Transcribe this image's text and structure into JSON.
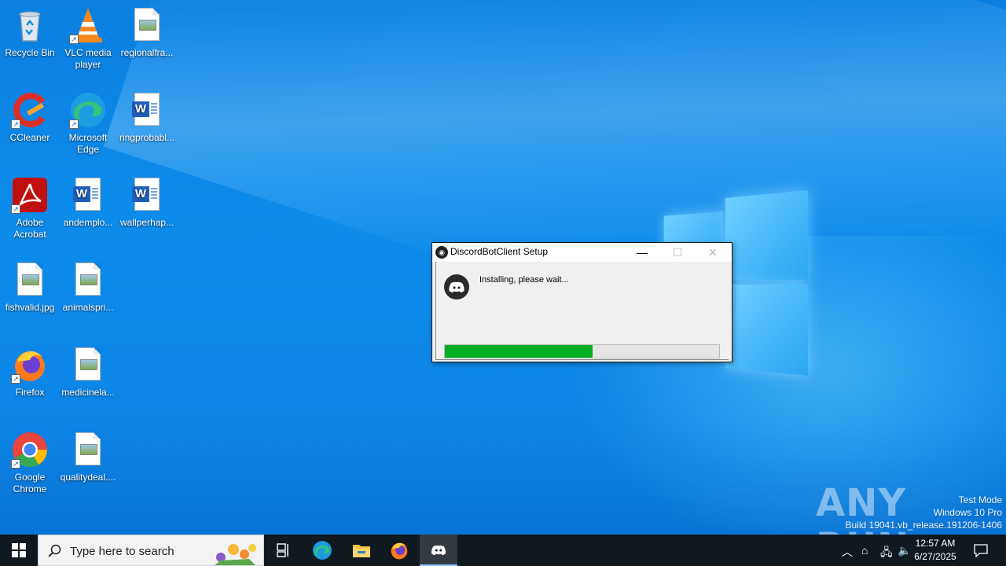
{
  "desktop": {
    "icons": [
      {
        "label": "Recycle Bin"
      },
      {
        "label": "VLC media player"
      },
      {
        "label": "regionalfra..."
      },
      {
        "label": "CCleaner"
      },
      {
        "label": "Microsoft Edge"
      },
      {
        "label": "ringprobabl..."
      },
      {
        "label": "Adobe Acrobat"
      },
      {
        "label": "andemplo..."
      },
      {
        "label": "wallperhap..."
      },
      {
        "label": "fishvalid.jpg"
      },
      {
        "label": "animalspri..."
      },
      {
        "label": "Firefox"
      },
      {
        "label": "medicinela..."
      },
      {
        "label": "Google Chrome"
      },
      {
        "label": "qualitydeal...."
      }
    ]
  },
  "dialog": {
    "title": "DiscordBotClient Setup",
    "status": "Installing, please wait...",
    "progress_percent": 54,
    "minimize": "—",
    "maximize": "☐",
    "close": "✕"
  },
  "watermark": {
    "brand": "ANY RUN",
    "line1": "Test Mode",
    "line2": "Windows 10 Pro",
    "line3": "Build 19041.vb_release.191206-1406"
  },
  "taskbar": {
    "search_placeholder": "Type here to search",
    "time": "12:57 AM",
    "date": "6/27/2025",
    "pinned": [
      "task-view",
      "edge",
      "file-explorer",
      "firefox",
      "discord"
    ]
  },
  "colors": {
    "progress_fill": "#06b025",
    "taskbar_bg": "#101820",
    "desktop_blue": "#0a7fe0"
  }
}
